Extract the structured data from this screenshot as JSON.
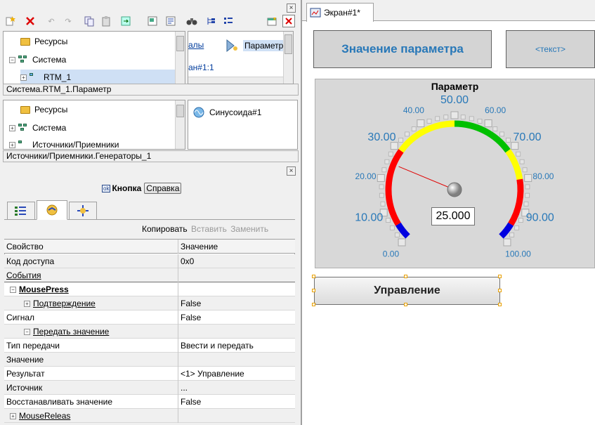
{
  "toolbar": {
    "icons": [
      "new-menu-icon",
      "delete-icon",
      "undo-icon",
      "redo-icon",
      "copy-icon",
      "paste-icon",
      "refresh-menu-icon",
      "properties-icon",
      "find-icon",
      "tree-icon",
      "list-icon",
      "new-window-icon",
      "close-icon"
    ]
  },
  "top_tree": {
    "items": [
      "Ресурсы",
      "Система",
      "RTM_1"
    ],
    "status": "Система.RTM_1.Параметр"
  },
  "top_right_panel": {
    "fragment_left": "алы",
    "item_label": "Параметр",
    "fragment_bottom": "ан#1:1"
  },
  "source_tree": {
    "items": [
      "Ресурсы",
      "Система",
      "Источники/Приемники"
    ],
    "status": "Источники/Приемники.Генераторы_1"
  },
  "generator": {
    "label": "Синусоида#1"
  },
  "properties": {
    "object_label": "Кнопка",
    "help_button": "Справка",
    "tabs": [
      "properties-tab-icon",
      "events-tab-icon",
      "transform-tab-icon"
    ],
    "actions": {
      "copy": "Копировать",
      "paste": "Вставить",
      "replace": "Заменить"
    },
    "headers": {
      "property": "Свойство",
      "value": "Значение"
    },
    "rows": [
      {
        "name": "Код доступа",
        "value": "0x0"
      },
      {
        "name": "События",
        "value": ""
      },
      {
        "name": "MousePress",
        "value": ""
      },
      {
        "name": "Подтверждение",
        "value": "False"
      },
      {
        "name": "Сигнал",
        "value": "False"
      },
      {
        "name": "Передать значение",
        "value": ""
      },
      {
        "name": "Тип передачи",
        "value": "Ввести и передать"
      },
      {
        "name": "Значение",
        "value": ""
      },
      {
        "name": "Результат",
        "value": "<1> Управление"
      },
      {
        "name": "Источник",
        "value": "..."
      },
      {
        "name": "Восстанавливать значение",
        "value": "False"
      },
      {
        "name": "MouseReleas",
        "value": ""
      }
    ]
  },
  "editor": {
    "tab_label": "Экран#1*",
    "value_button": "Значение параметра",
    "text_button": "<текст>",
    "gauge": {
      "title": "Параметр",
      "value": 25.0,
      "value_text": "25.000",
      "min": 0,
      "max": 100,
      "tick_labels": [
        "0.00",
        "10.00",
        "20.00",
        "30.00",
        "40.00",
        "50.00",
        "60.00",
        "70.00",
        "80.00",
        "90.00",
        "100.00"
      ],
      "colors": {
        "low": "#0000e0",
        "warn": "#ff0000",
        "caution": "#ffff00",
        "normal": "#00c000",
        "needle": "#e00000",
        "labels": "#2878b8"
      }
    },
    "control_button": "Управление"
  }
}
